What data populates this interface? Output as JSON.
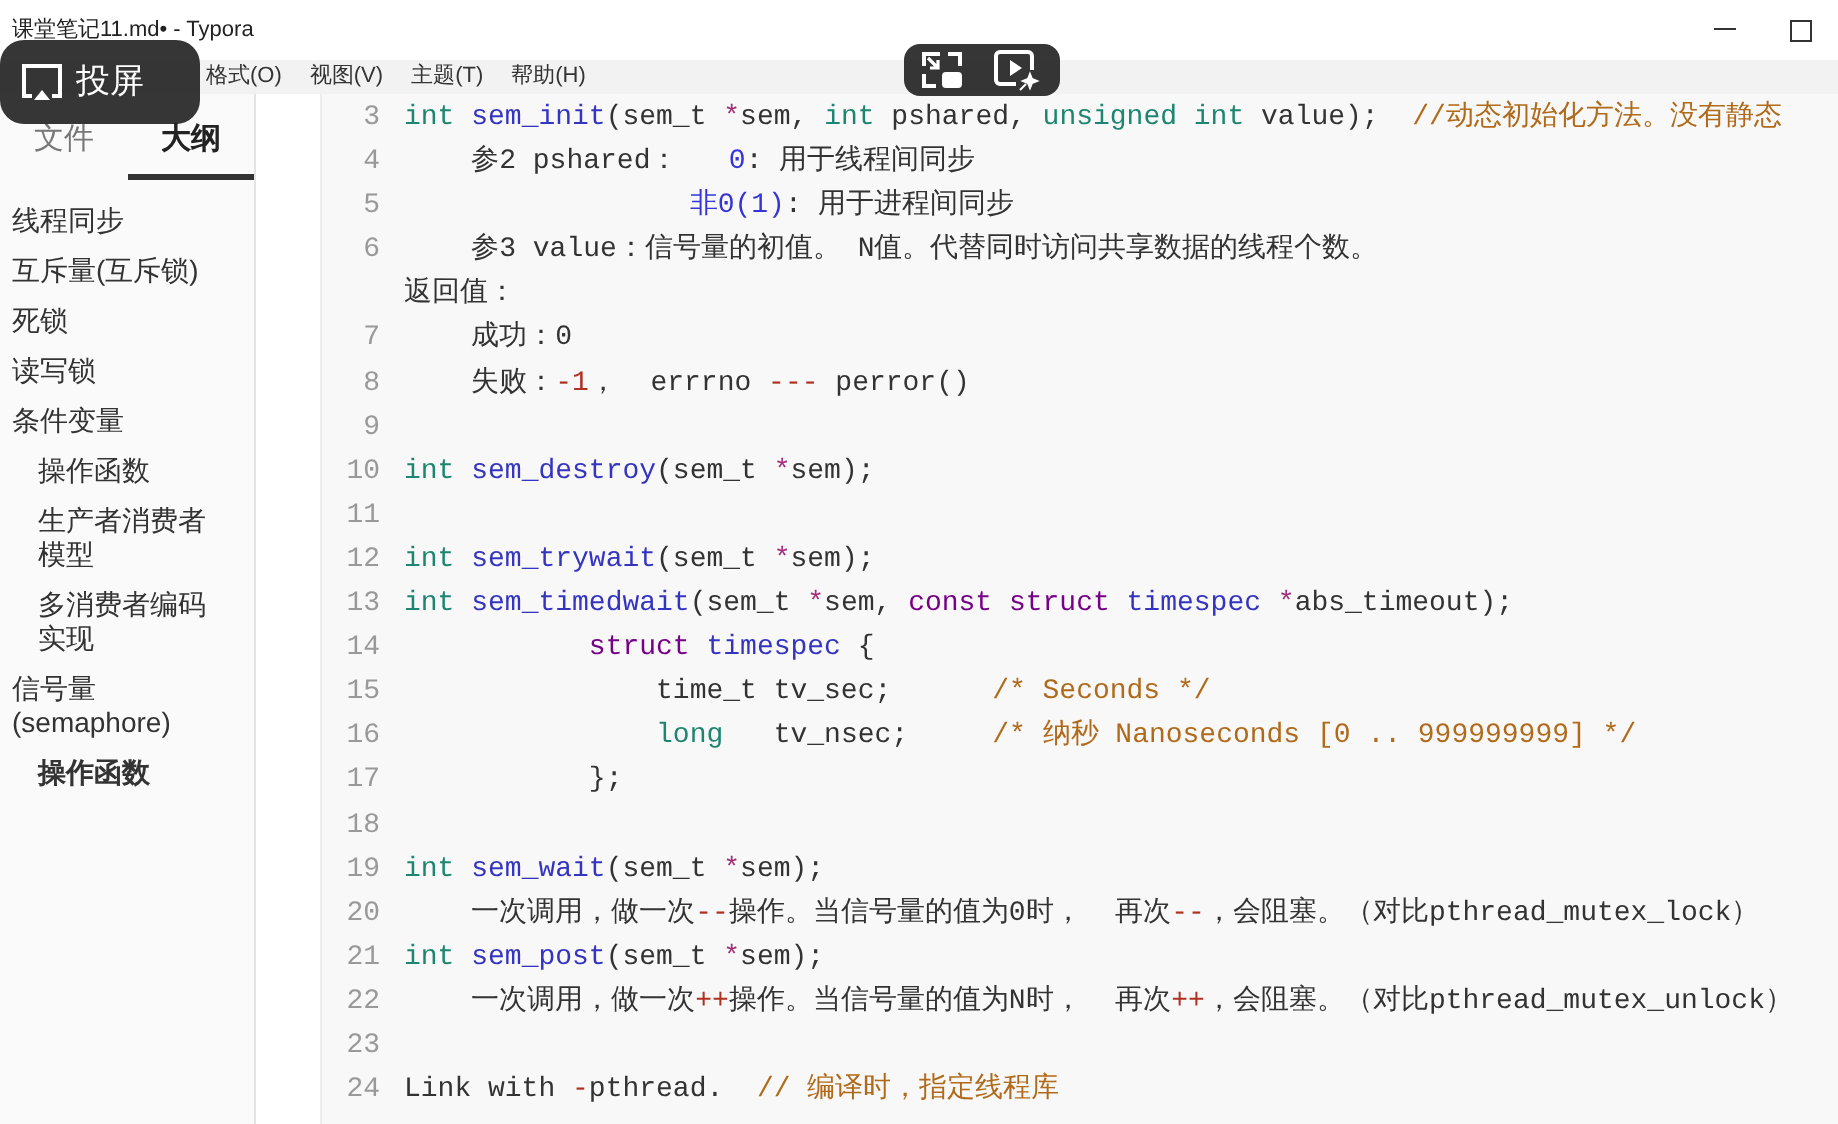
{
  "window": {
    "title": "课堂笔记11.md• - Typora"
  },
  "cast_overlay": {
    "label": "投屏"
  },
  "menu": [
    "格式(O)",
    "视图(V)",
    "主题(T)",
    "帮助(H)"
  ],
  "sidebar": {
    "tabs": [
      {
        "label": "文件",
        "selected": false
      },
      {
        "label": "大纲",
        "selected": true
      }
    ],
    "outline": [
      {
        "label": "线程同步",
        "selected": false
      },
      {
        "label": "互斥量(互斥锁)",
        "selected": false
      },
      {
        "label": "死锁",
        "selected": false
      },
      {
        "label": "读写锁",
        "selected": false
      },
      {
        "label": "条件变量",
        "selected": false,
        "children": [
          {
            "label": "操作函数",
            "selected": false
          },
          {
            "label": "生产者消费者模型",
            "selected": false
          },
          {
            "label": "多消费者编码实现",
            "selected": false
          }
        ]
      },
      {
        "label": "信号量(semaphore)",
        "selected": false,
        "children": [
          {
            "label": "操作函数",
            "selected": true
          }
        ]
      }
    ]
  },
  "code": {
    "lines": [
      {
        "number": "3",
        "tokens": [
          {
            "text": "int ",
            "kind": "type"
          },
          {
            "text": "sem_init",
            "kind": "def"
          },
          {
            "text": "(sem_t "
          },
          {
            "text": "*",
            "kind": "op"
          },
          {
            "text": "sem, "
          },
          {
            "text": "int",
            "kind": "type"
          },
          {
            "text": " pshared, "
          },
          {
            "text": "unsigned int",
            "kind": "type"
          },
          {
            "text": " value);  "
          },
          {
            "text": "//动态初始化方法。没有静态",
            "kind": "cmt"
          }
        ]
      },
      {
        "number": "4",
        "tokens": [
          {
            "text": "    参2 pshared：   "
          },
          {
            "text": "0",
            "kind": "num"
          },
          {
            "text": ": 用于线程间同步"
          }
        ]
      },
      {
        "number": "5",
        "tokens": [
          {
            "text": "                 非0(1)",
            "kind": "num"
          },
          {
            "text": ": 用于进程间同步"
          }
        ]
      },
      {
        "number": "6",
        "tokens": [
          {
            "text": "    参3 value：信号量的初值。 N值。代替同时访问共享数据的线程个数。"
          }
        ]
      },
      {
        "tokens": [
          {
            "text": "返回值："
          }
        ]
      },
      {
        "number": "7",
        "tokens": [
          {
            "text": "    成功：0"
          }
        ]
      },
      {
        "number": "8",
        "tokens": [
          {
            "text": "    失败："
          },
          {
            "text": "-1",
            "kind": "neg"
          },
          {
            "text": "，  errrno "
          },
          {
            "text": "---",
            "kind": "neg"
          },
          {
            "text": " perror()"
          }
        ]
      },
      {
        "number": "9"
      },
      {
        "number": "10",
        "tokens": [
          {
            "text": "int ",
            "kind": "type"
          },
          {
            "text": "sem_destroy",
            "kind": "def"
          },
          {
            "text": "(sem_t "
          },
          {
            "text": "*",
            "kind": "op"
          },
          {
            "text": "sem);"
          }
        ]
      },
      {
        "number": "11"
      },
      {
        "number": "12",
        "tokens": [
          {
            "text": "int ",
            "kind": "type"
          },
          {
            "text": "sem_trywait",
            "kind": "def"
          },
          {
            "text": "(sem_t "
          },
          {
            "text": "*",
            "kind": "op"
          },
          {
            "text": "sem);"
          }
        ]
      },
      {
        "number": "13",
        "tokens": [
          {
            "text": "int ",
            "kind": "type"
          },
          {
            "text": "sem_timedwait",
            "kind": "def"
          },
          {
            "text": "(sem_t "
          },
          {
            "text": "*",
            "kind": "op"
          },
          {
            "text": "sem, "
          },
          {
            "text": "const struct ",
            "kind": "kw"
          },
          {
            "text": "timespec ",
            "kind": "def"
          },
          {
            "text": "*",
            "kind": "op"
          },
          {
            "text": "abs_timeout);"
          }
        ]
      },
      {
        "number": "14",
        "tokens": [
          {
            "text": "           struct ",
            "kind": "kw"
          },
          {
            "text": "timespec",
            "kind": "def"
          },
          {
            "text": " {"
          }
        ]
      },
      {
        "number": "15",
        "tokens": [
          {
            "text": "               time_t tv_sec;      "
          },
          {
            "text": "/* Seconds */",
            "kind": "cmt"
          }
        ]
      },
      {
        "number": "16",
        "tokens": [
          {
            "text": "               long",
            "kind": "type"
          },
          {
            "text": "   tv_nsec;     "
          },
          {
            "text": "/* 纳秒 Nanoseconds [0 .. 999999999] */",
            "kind": "cmt"
          }
        ]
      },
      {
        "number": "17",
        "tokens": [
          {
            "text": "           };"
          }
        ]
      },
      {
        "number": "18"
      },
      {
        "number": "19",
        "tokens": [
          {
            "text": "int ",
            "kind": "type"
          },
          {
            "text": "sem_wait",
            "kind": "def"
          },
          {
            "text": "(sem_t "
          },
          {
            "text": "*",
            "kind": "op"
          },
          {
            "text": "sem);"
          }
        ]
      },
      {
        "number": "20",
        "tokens": [
          {
            "text": "    一次调用，做一次"
          },
          {
            "text": "--",
            "kind": "neg"
          },
          {
            "text": "操作。当信号量的值为0时，  再次"
          },
          {
            "text": "--",
            "kind": "neg"
          },
          {
            "text": "，会阻塞。（对比pthread_mutex_lock）"
          }
        ]
      },
      {
        "number": "21",
        "tokens": [
          {
            "text": "int ",
            "kind": "type"
          },
          {
            "text": "sem_post",
            "kind": "def"
          },
          {
            "text": "(sem_t "
          },
          {
            "text": "*",
            "kind": "op"
          },
          {
            "text": "sem);"
          }
        ]
      },
      {
        "number": "22",
        "tokens": [
          {
            "text": "    一次调用，做一次"
          },
          {
            "text": "++",
            "kind": "neg"
          },
          {
            "text": "操作。当信号量的值为N时，  再次"
          },
          {
            "text": "++",
            "kind": "neg"
          },
          {
            "text": "，会阻塞。（对比pthread_mutex_unlock）"
          }
        ]
      },
      {
        "number": "23"
      },
      {
        "number": "24",
        "tokens": [
          {
            "text": "Link with "
          },
          {
            "text": "-",
            "kind": "neg"
          },
          {
            "text": "pthread.  "
          },
          {
            "text": "// 编译时，指定线程库",
            "kind": "cmt"
          }
        ]
      }
    ]
  }
}
